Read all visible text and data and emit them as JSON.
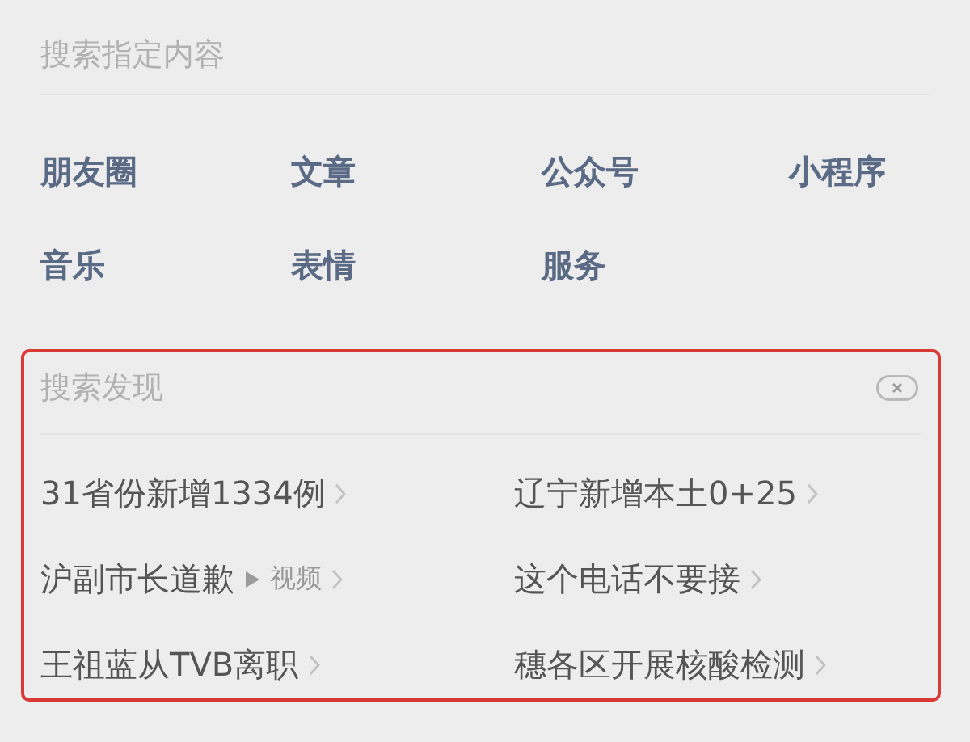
{
  "search_scope": {
    "title": "搜索指定内容",
    "items": [
      {
        "label": "朋友圈"
      },
      {
        "label": "文章"
      },
      {
        "label": "公众号"
      },
      {
        "label": "小程序"
      },
      {
        "label": "音乐"
      },
      {
        "label": "表情"
      },
      {
        "label": "服务"
      }
    ]
  },
  "discover": {
    "title": "搜索发现",
    "highlighted": true,
    "items": [
      {
        "text": "31省份新增1334例"
      },
      {
        "text": "辽宁新增本土0+25"
      },
      {
        "text": "沪副市长道歉",
        "tag": "视频"
      },
      {
        "text": "这个电话不要接"
      },
      {
        "text": "王祖蓝从TVB离职"
      },
      {
        "text": "穗各区开展核酸检测"
      }
    ]
  }
}
